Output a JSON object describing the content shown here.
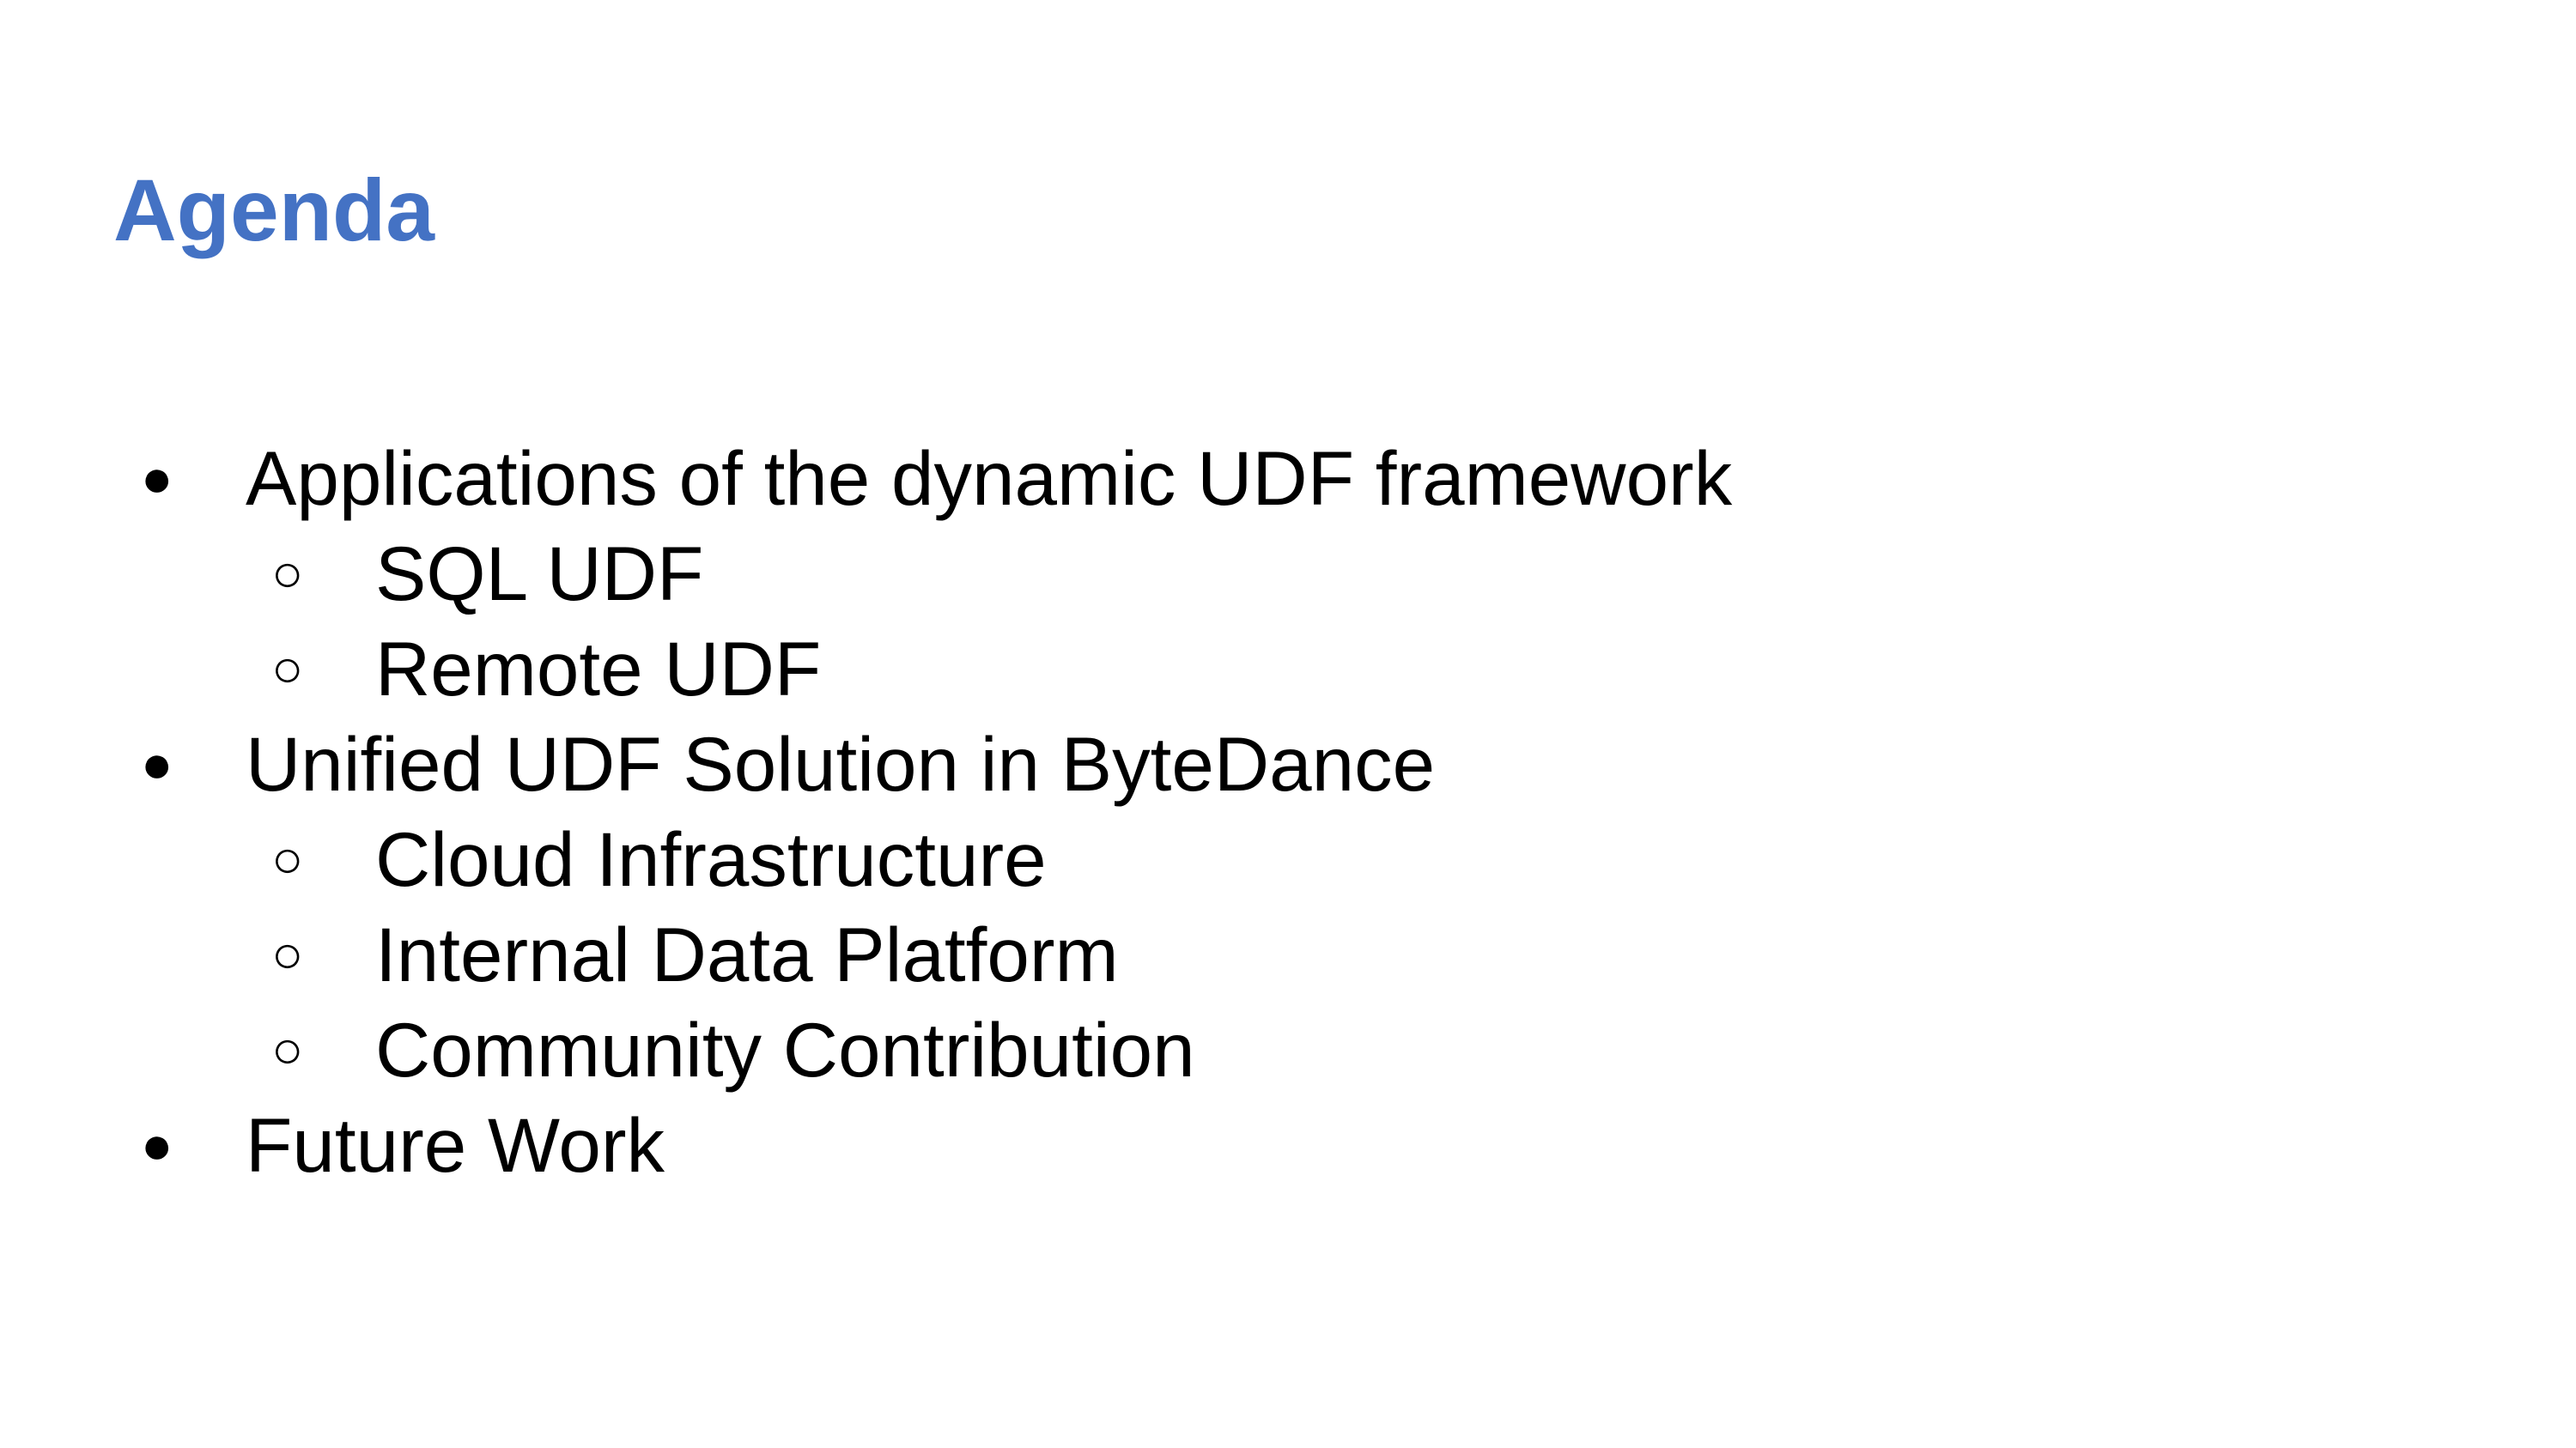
{
  "slide": {
    "title": "Agenda",
    "title_color": "#4472c4",
    "items": [
      {
        "level": 1,
        "bullet": "●",
        "bullet_icon": "filled-circle-bullet",
        "label": "Applications of the dynamic UDF framework"
      },
      {
        "level": 2,
        "bullet": "○",
        "bullet_icon": "hollow-circle-bullet",
        "label": "SQL UDF"
      },
      {
        "level": 2,
        "bullet": "○",
        "bullet_icon": "hollow-circle-bullet",
        "label": "Remote UDF"
      },
      {
        "level": 1,
        "bullet": "●",
        "bullet_icon": "filled-circle-bullet",
        "label": "Unified UDF Solution in ByteDance"
      },
      {
        "level": 2,
        "bullet": "○",
        "bullet_icon": "hollow-circle-bullet",
        "label": "Cloud Infrastructure"
      },
      {
        "level": 2,
        "bullet": "○",
        "bullet_icon": "hollow-circle-bullet",
        "label": "Internal Data Platform"
      },
      {
        "level": 2,
        "bullet": "○",
        "bullet_icon": "hollow-circle-bullet",
        "label": "Community Contribution"
      },
      {
        "level": 1,
        "bullet": "●",
        "bullet_icon": "filled-circle-bullet",
        "label": "Future Work"
      }
    ]
  }
}
